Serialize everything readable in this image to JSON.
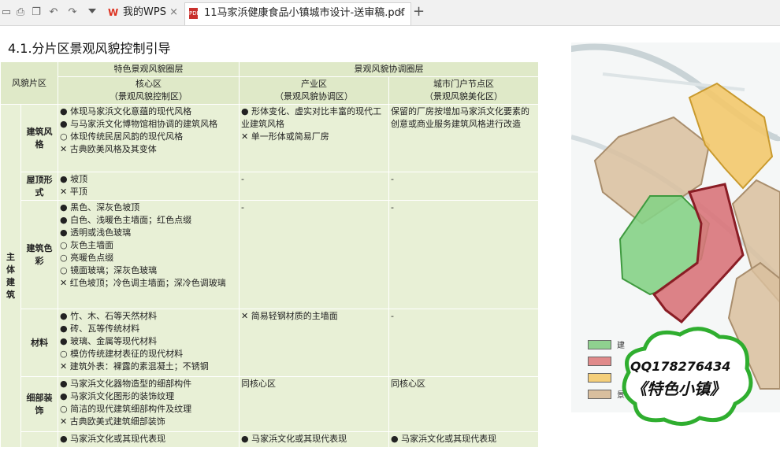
{
  "toolbar": {
    "icons": [
      "open-icon",
      "print-icon",
      "copy-icon",
      "undo-icon",
      "redo-icon",
      "dropdown-icon"
    ]
  },
  "tabs": [
    {
      "label": "我的WPS",
      "close": "×"
    },
    {
      "label": "11马家浜健康食品小镇城市设计-送审稿.pdf",
      "close": "×"
    }
  ],
  "new_tab": "+",
  "doc": {
    "heading": "4.1.分片区景观风貌控制引导",
    "table": {
      "corner": "风貌片区",
      "group1": "特色景观风貌圈层",
      "group2": "景观风貌协调圈层",
      "zone1_name": "核心区",
      "zone1_sub": "（景观风貌控制区）",
      "zone2_name": "产业区",
      "zone2_sub": "（景观风貌协调区）",
      "zone3_name": "城市门户节点区",
      "zone3_sub": "（景观风貌美化区）",
      "main_cat": "主体建筑",
      "rows": {
        "style": {
          "label": "建筑风格",
          "core": [
            "● 体现马家浜文化意蕴的现代风格",
            "● 与马家浜文化博物馆相协调的建筑风格",
            "○ 体现传统民居风韵的现代风格",
            "✕ 古典欧美风格及其变体"
          ],
          "industry": [
            "● 形体变化、虚实对比丰富的现代工业建筑风格",
            "✕ 单一形体或简易厂房"
          ],
          "gateway": [
            "保留的厂房按增加马家浜文化要素的创意或商业服务建筑风格进行改造"
          ]
        },
        "roof": {
          "label": "屋顶形式",
          "core": [
            "● 坡顶",
            "✕ 平顶"
          ],
          "industry": [
            "-"
          ],
          "gateway": [
            "-"
          ]
        },
        "color": {
          "label": "建筑色彩",
          "core": [
            "● 黑色、深灰色坡顶",
            "● 白色、浅暖色主墙面；红色点缀",
            "● 透明或浅色玻璃",
            "○ 灰色主墙面",
            "○ 亮暖色点缀",
            "○ 镜面玻璃；深灰色玻璃",
            "✕ 红色坡顶；冷色调主墙面；深冷色调玻璃"
          ],
          "industry": [
            "-"
          ],
          "gateway": [
            "-"
          ]
        },
        "material": {
          "label": "材料",
          "core": [
            "● 竹、木、石等天然材料",
            "● 砖、瓦等传统材料",
            "● 玻璃、金属等现代材料",
            "○ 模仿传统建材表征的现代材料",
            "✕ 建筑外表：裸露的素混凝土；不锈钢"
          ],
          "industry": [
            "✕ 简易轻钢材质的主墙面"
          ],
          "gateway": [
            "-"
          ]
        },
        "detail": {
          "label": "细部装饰",
          "core": [
            "● 马家浜文化器物造型的细部构件",
            "● 马家浜文化图形的装饰纹理",
            "○ 简洁的现代建筑细部构件及纹理",
            "✕ 古典欧美式建筑细部装饰"
          ],
          "industry": [
            "同核心区"
          ],
          "gateway": [
            "同核心区"
          ]
        },
        "culture": {
          "core": [
            "● 马家浜文化或其现代表现"
          ],
          "industry": [
            "● 马家浜文化或其现代表现"
          ],
          "gateway": [
            "● 马家浜文化或其现代表现"
          ]
        }
      }
    }
  },
  "map": {
    "legend": [
      {
        "color": "#8fd18f",
        "label": "建"
      },
      {
        "color": "#e08a8a",
        "label": ""
      },
      {
        "color": "#f5cf7a",
        "label": ""
      },
      {
        "color": "#d9bf9e",
        "label": "景"
      }
    ],
    "zone_colors": {
      "green": "#86d186",
      "red": "#d9747a",
      "yellow": "#f3c86b",
      "tan": "#d9bf9e"
    }
  },
  "watermark": {
    "qq": "QQ178276434",
    "brand": "《特色小镇》"
  }
}
